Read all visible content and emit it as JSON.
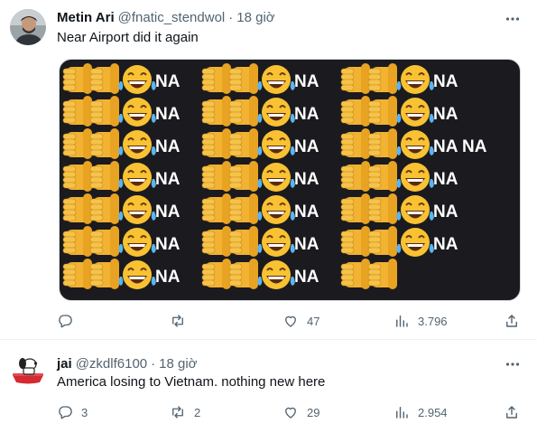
{
  "tweets": [
    {
      "author_name": "Metin Ari",
      "handle": "@fnatic_stendwol",
      "separator": "·",
      "time": "18 giờ",
      "text": "Near Airport did it again",
      "media": {
        "columns": [
          [
            "NA",
            "NA",
            "NA",
            "NA",
            "NA",
            "NA",
            "NA"
          ],
          [
            "NA",
            "NA",
            "NA",
            "NA",
            "NA",
            "NA",
            "NA"
          ],
          [
            "NA",
            "NA",
            "NA NA",
            "NA",
            "NA",
            "NA"
          ]
        ]
      },
      "actions": {
        "replies": "",
        "retweets": "",
        "likes": "47",
        "views": "3.796"
      }
    },
    {
      "author_name": "jai",
      "handle": "@zkdlf6100",
      "separator": "·",
      "time": "18 giờ",
      "text": "America losing to Vietnam. nothing new here",
      "actions": {
        "replies": "3",
        "retweets": "2",
        "likes": "29",
        "views": "2.954"
      }
    }
  ],
  "icons": [
    "more-icon",
    "reply-icon",
    "retweet-icon",
    "like-icon",
    "views-icon",
    "share-icon"
  ],
  "colors": {
    "secondary_text": "#536471",
    "divider": "#eff3f4",
    "media_bg": "#1b1b1f"
  }
}
